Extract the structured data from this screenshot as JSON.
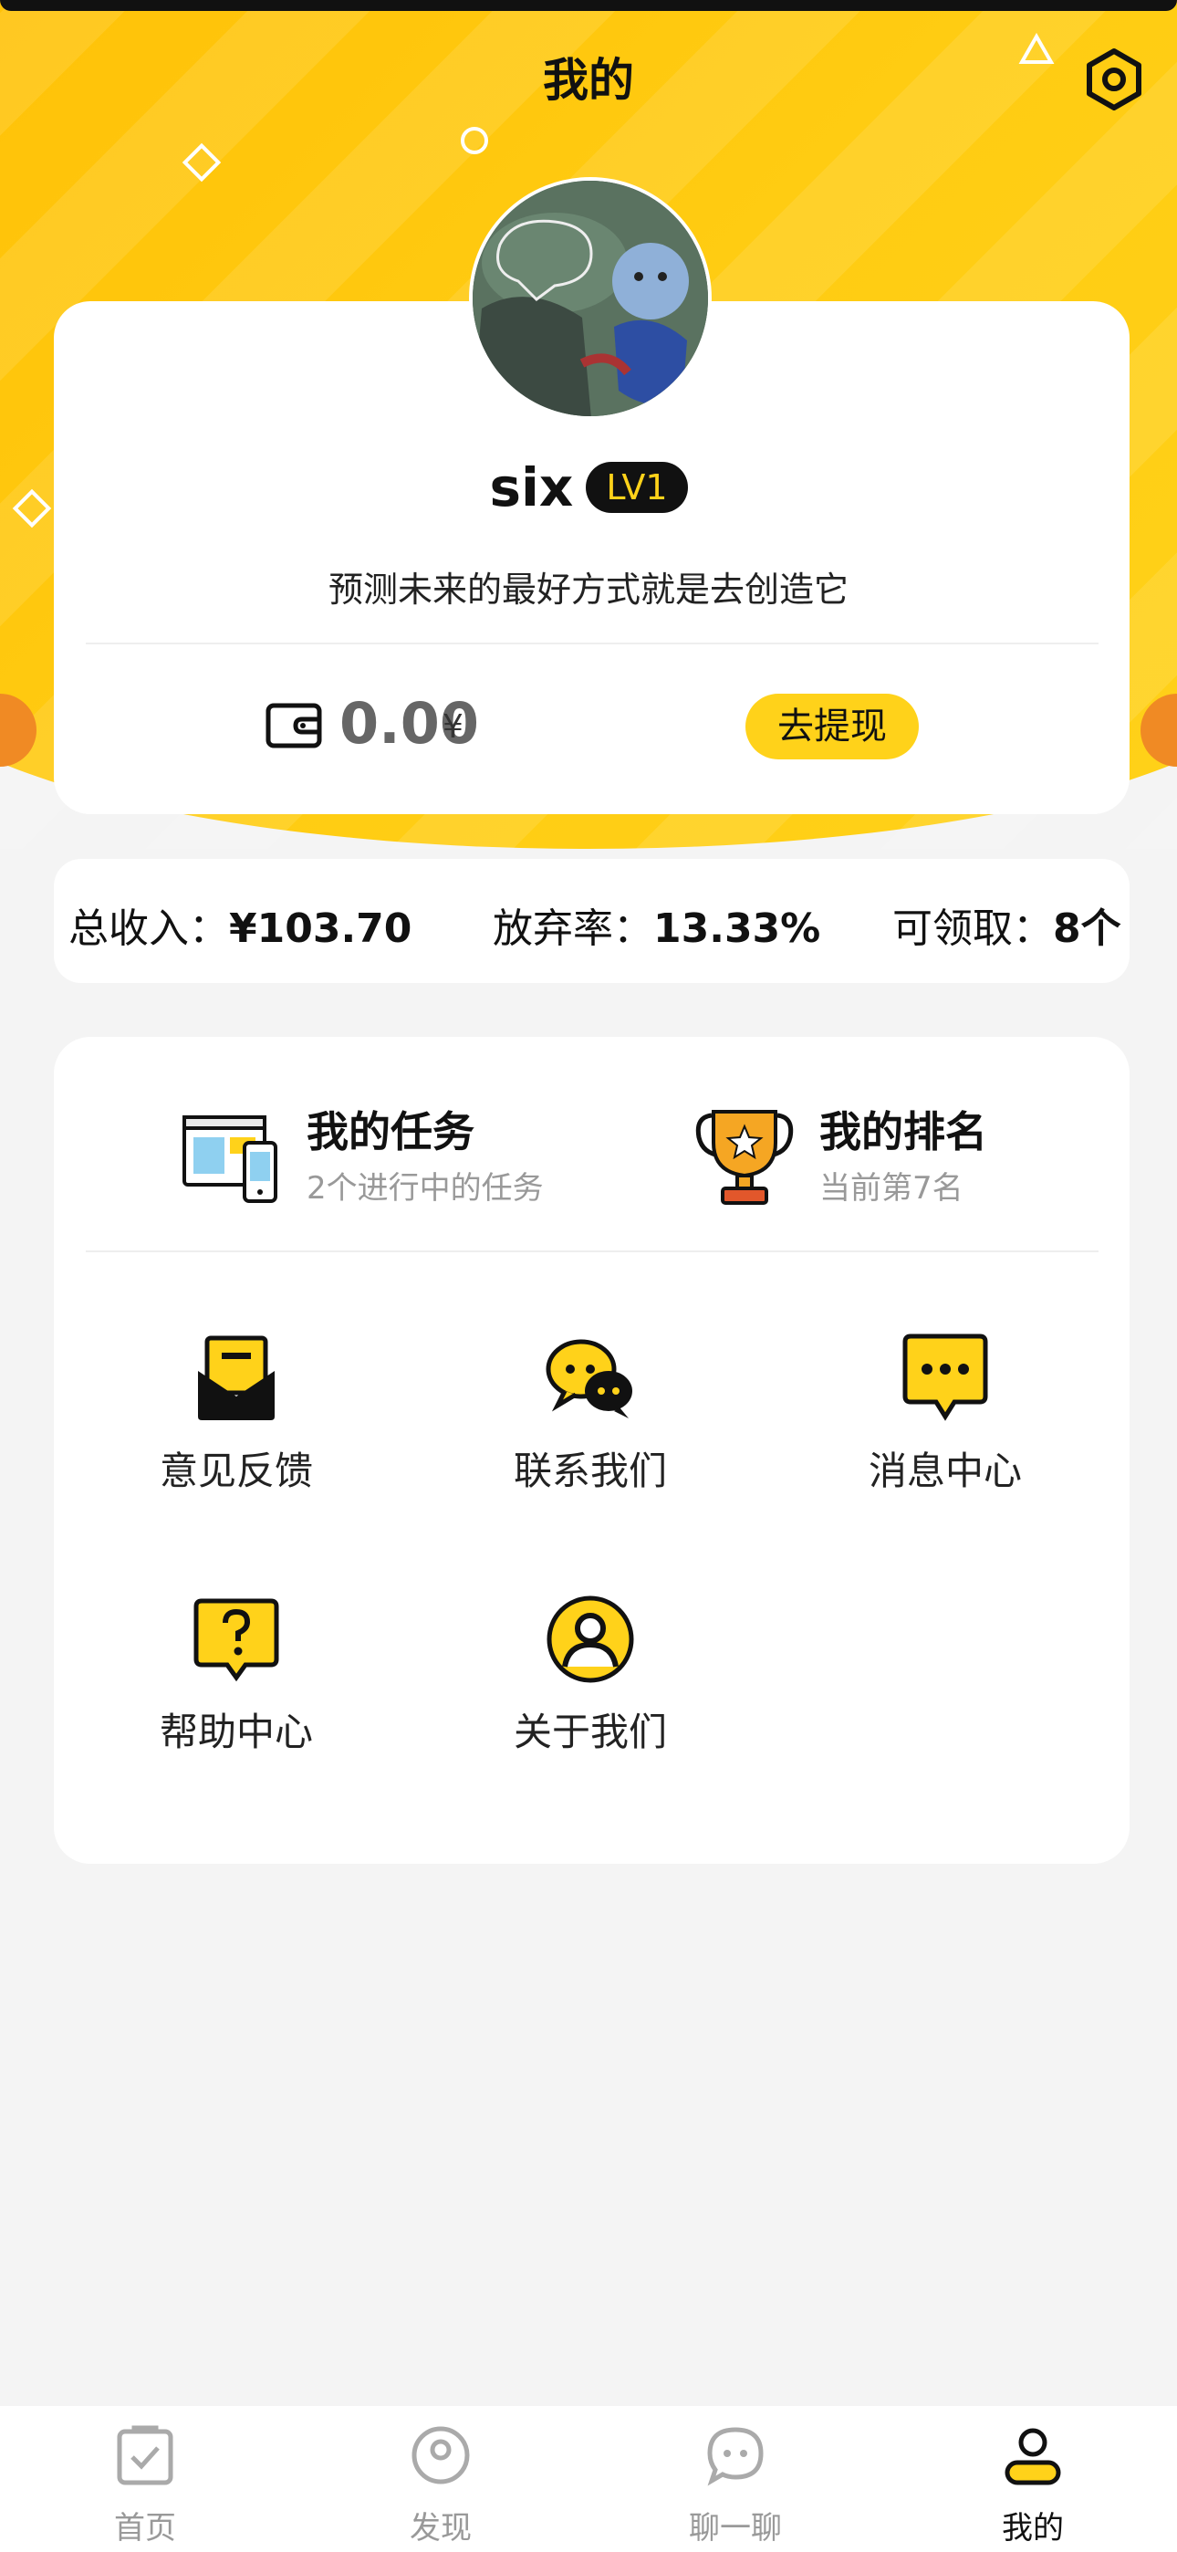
{
  "header": {
    "title": "我的",
    "settings_icon": "settings-hexagon-icon"
  },
  "profile": {
    "name": "six",
    "level": "LV1",
    "motto": "预测未来的最好方式就是去创造它",
    "balance": "0.00",
    "currency": "¥",
    "withdraw_label": "去提现"
  },
  "stats": {
    "total_income_label": "总收入：",
    "total_income_value": "¥103.70",
    "abandon_rate_label": "放弃率：",
    "abandon_rate_value": "13.33%",
    "claimable_label": "可领取：",
    "claimable_value": "8个"
  },
  "features": {
    "tasks_title": "我的任务",
    "tasks_sub": "2个进行中的任务",
    "rank_title": "我的排名",
    "rank_sub": "当前第7名"
  },
  "menu": {
    "feedback": "意见反馈",
    "contact": "联系我们",
    "messages": "消息中心",
    "help": "帮助中心",
    "about": "关于我们"
  },
  "tabbar": {
    "home": "首页",
    "discover": "发现",
    "chat": "聊一聊",
    "mine": "我的"
  },
  "colors": {
    "accent": "#ffd21a",
    "dark": "#111111",
    "orange": "#f08a24"
  }
}
